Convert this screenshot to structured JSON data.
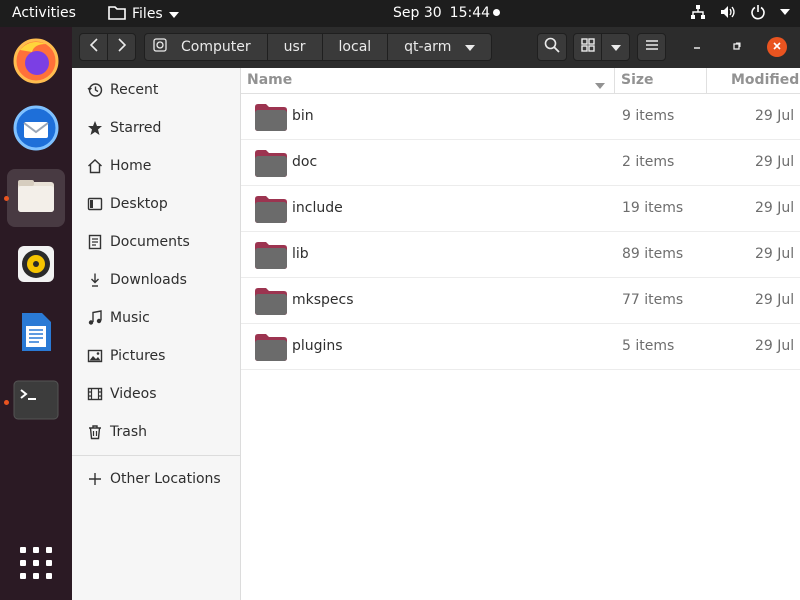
{
  "topbar": {
    "activities": "Activities",
    "app_menu": "Files",
    "date": "Sep 30",
    "time": "15:44"
  },
  "dock": {
    "items": [
      {
        "name": "firefox",
        "running": false
      },
      {
        "name": "thunderbird",
        "running": false
      },
      {
        "name": "files",
        "running": true
      },
      {
        "name": "rhythmbox",
        "running": false
      },
      {
        "name": "libreoffice-writer",
        "running": false
      },
      {
        "name": "terminal",
        "running": true
      },
      {
        "name": "show-applications",
        "running": false
      }
    ]
  },
  "pathbar": {
    "crumbs": [
      "Computer",
      "usr",
      "local",
      "qt-arm"
    ]
  },
  "sidebar": {
    "items": [
      {
        "label": "Recent",
        "icon": "clock-icon"
      },
      {
        "label": "Starred",
        "icon": "star-icon"
      },
      {
        "label": "Home",
        "icon": "home-icon"
      },
      {
        "label": "Desktop",
        "icon": "desktop-icon"
      },
      {
        "label": "Documents",
        "icon": "document-icon"
      },
      {
        "label": "Downloads",
        "icon": "download-icon"
      },
      {
        "label": "Music",
        "icon": "music-icon"
      },
      {
        "label": "Pictures",
        "icon": "picture-icon"
      },
      {
        "label": "Videos",
        "icon": "film-icon"
      },
      {
        "label": "Trash",
        "icon": "trash-icon"
      }
    ],
    "other_locations": "Other Locations"
  },
  "list": {
    "columns": {
      "name": "Name",
      "size": "Size",
      "modified": "Modified"
    },
    "rows": [
      {
        "name": "bin",
        "size": "9 items",
        "modified": "29 Jul"
      },
      {
        "name": "doc",
        "size": "2 items",
        "modified": "29 Jul"
      },
      {
        "name": "include",
        "size": "19 items",
        "modified": "29 Jul"
      },
      {
        "name": "lib",
        "size": "89 items",
        "modified": "29 Jul"
      },
      {
        "name": "mkspecs",
        "size": "77 items",
        "modified": "29 Jul"
      },
      {
        "name": "plugins",
        "size": "5 items",
        "modified": "29 Jul"
      }
    ]
  },
  "colors": {
    "accent": "#e95420",
    "topbar": "#1d1d1d",
    "dock": "#2b1a24",
    "headerbar": "#2c2c2c",
    "folder": "#6b6b6b",
    "folder_tab": "#9c3450"
  }
}
